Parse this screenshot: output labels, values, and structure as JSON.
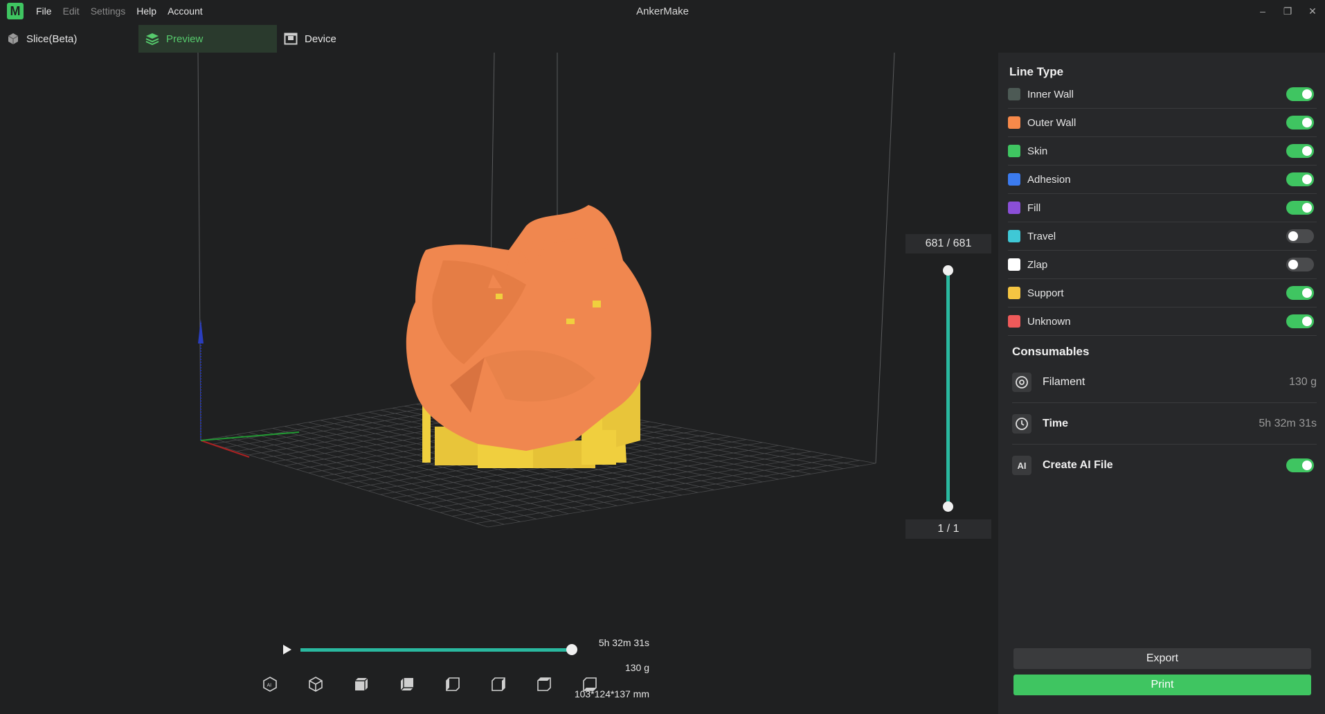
{
  "app": {
    "logo_letter": "M",
    "title": "AnkerMake"
  },
  "menu": {
    "items": [
      "File",
      "Edit",
      "Settings",
      "Help",
      "Account"
    ]
  },
  "window_controls": {
    "minimize": "–",
    "restore": "❐",
    "close": "✕"
  },
  "tabs": [
    {
      "label": "Slice(Beta)",
      "icon": "cube-icon"
    },
    {
      "label": "Preview",
      "icon": "layers-icon",
      "active": true
    },
    {
      "label": "Device",
      "icon": "printer-icon"
    }
  ],
  "layer_slider": {
    "top_label": "681  / 681",
    "bottom_label": "1  / 1"
  },
  "playback": {
    "progress": 1.0
  },
  "stats": {
    "time": "5h 32m 31s",
    "weight": "130 g",
    "dimensions": "103*124*137 mm"
  },
  "view_buttons": [
    "ai-view-icon",
    "iso-view-icon",
    "front-view-icon",
    "back-view-icon",
    "left-view-icon",
    "right-view-icon",
    "top-view-icon",
    "bottom-view-icon"
  ],
  "line_type": {
    "title": "Line Type",
    "items": [
      {
        "label": "Inner Wall",
        "color": "#4d5a55",
        "on": true
      },
      {
        "label": "Outer Wall",
        "color": "#f7894a",
        "on": true
      },
      {
        "label": "Skin",
        "color": "#3fc561",
        "on": true
      },
      {
        "label": "Adhesion",
        "color": "#3b7bef",
        "on": true
      },
      {
        "label": "Fill",
        "color": "#8b4fd8",
        "on": true
      },
      {
        "label": "Travel",
        "color": "#3fc8d6",
        "on": false
      },
      {
        "label": "Zlap",
        "color": "#ffffff",
        "on": false
      },
      {
        "label": "Support",
        "color": "#f5c542",
        "on": true
      },
      {
        "label": "Unknown",
        "color": "#ef5a5a",
        "on": true
      }
    ]
  },
  "consumables": {
    "title": "Consumables",
    "filament": {
      "label": "Filament",
      "value": "130 g"
    },
    "time": {
      "label": "Time",
      "value": "5h 32m 31s"
    },
    "ai_file": {
      "label": "Create AI File",
      "icon_text": "AI",
      "on": true
    }
  },
  "buttons": {
    "export": "Export",
    "print": "Print"
  },
  "colors": {
    "accent": "#3fc561",
    "slider": "#2ab9a0",
    "model": "#f0874f",
    "support": "#f0cf3e"
  }
}
